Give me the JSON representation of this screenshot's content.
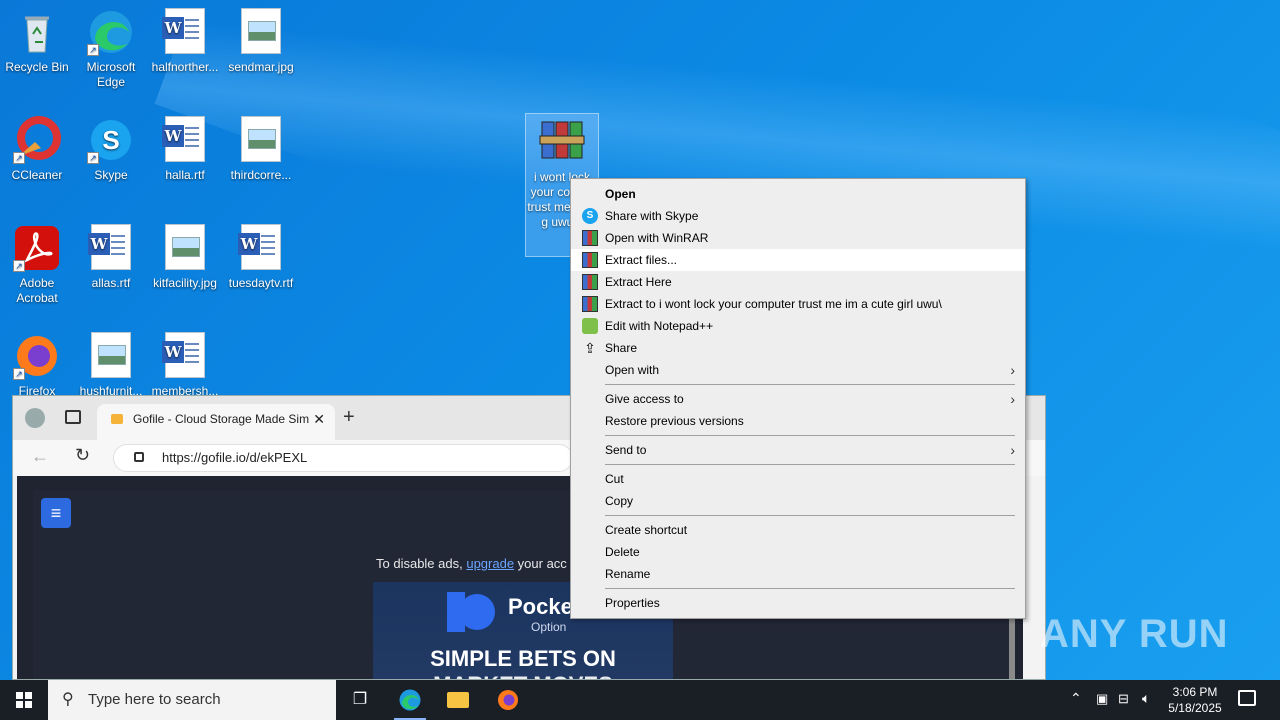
{
  "desktop": {
    "icons": [
      {
        "label": "Recycle Bin"
      },
      {
        "label": "Microsoft Edge"
      },
      {
        "label": "halfnorther..."
      },
      {
        "label": "sendmar.jpg"
      },
      {
        "label": "CCleaner"
      },
      {
        "label": "Skype"
      },
      {
        "label": "halla.rtf"
      },
      {
        "label": "thirdcorre..."
      },
      {
        "label": "Adobe Acrobat"
      },
      {
        "label": "allas.rtf"
      },
      {
        "label": "kitfacility.jpg"
      },
      {
        "label": "tuesdaytv.rtf"
      },
      {
        "label": "Firefox"
      },
      {
        "label": "hushfurnit..."
      },
      {
        "label": "membersh..."
      },
      {
        "label": "i wont lock your computer trust me im a cute girl uwu.zip",
        "display": "i wont lock your compu trust me cute g uwu.z"
      }
    ]
  },
  "browser": {
    "tab_title": "Gofile - Cloud Storage Made Sim",
    "url": "https://gofile.io/d/ekPEXL",
    "page": {
      "ad_notice_prefix": "To disable ads, ",
      "ad_notice_link": "upgrade",
      "ad_notice_suffix": " your acc",
      "ad_brand": "Pocket",
      "ad_brand_sub": "Option",
      "ad_headline": "SIMPLE BETS ON",
      "ad_headline2": "MARKET MOVES"
    }
  },
  "context_menu": {
    "items": [
      {
        "label": "Open",
        "bold": true
      },
      {
        "label": "Share with Skype",
        "icon": "skype-icon"
      },
      {
        "label": "Open with WinRAR",
        "icon": "winrar-icon"
      },
      {
        "label": "Extract files...",
        "icon": "winrar-icon",
        "highlighted": true
      },
      {
        "label": "Extract Here",
        "icon": "winrar-icon"
      },
      {
        "label": "Extract to i wont lock your computer trust me im a cute girl uwu\\",
        "icon": "winrar-icon"
      },
      {
        "label": "Edit with Notepad++",
        "icon": "notepad-plus-plus-icon"
      },
      {
        "label": "Share",
        "icon": "share-icon"
      },
      {
        "label": "Open with",
        "submenu": true
      },
      {
        "label": "Give access to",
        "submenu": true
      },
      {
        "label": "Restore previous versions"
      },
      {
        "label": "Send to",
        "submenu": true
      },
      {
        "label": "Cut"
      },
      {
        "label": "Copy"
      },
      {
        "label": "Create shortcut"
      },
      {
        "label": "Delete"
      },
      {
        "label": "Rename"
      },
      {
        "label": "Properties"
      }
    ]
  },
  "watermark": "ANY RUN",
  "taskbar": {
    "search_placeholder": "Type here to search",
    "time": "3:06 PM",
    "date": "5/18/2025"
  },
  "colors": {
    "desktop_bg": "#0a78d7",
    "taskbar_bg": "#1a1e25",
    "menu_bg": "#eeeeee",
    "accent": "#2d6ae0"
  }
}
